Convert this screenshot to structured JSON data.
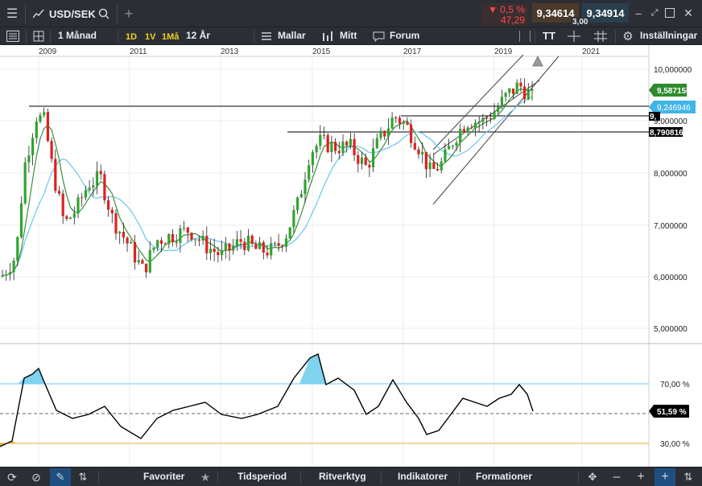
{
  "topbar": {
    "symbol": "USD/SEK",
    "change_pct": "▼ 0,5 %",
    "change_abs": "47,29",
    "bid": "9,34614",
    "ask": "9,34914",
    "spread": "3,00"
  },
  "toolbar": {
    "interval": "1 Månad",
    "range_1d": "1D",
    "range_1v": "1V",
    "range_1ma": "1Må",
    "range_12ar": "12 År",
    "mallar": "Mallar",
    "mitt": "Mitt",
    "forum": "Forum",
    "tt": "TT",
    "settings": "Inställningar"
  },
  "chart": {
    "x_labels": [
      "2009",
      "2011",
      "2013",
      "2015",
      "2017",
      "2019",
      "2021"
    ],
    "y_labels": [
      "10,000000",
      "9,000000",
      "8,000000",
      "7,000000",
      "6,000000",
      "5,000000"
    ],
    "price_tag_green": "9,587155",
    "price_tag_blue": "9,246946",
    "price_tag_black_1": "9,",
    "price_tag_black_2": "8,790816",
    "rsi_labels": [
      "70,00 %",
      "30,00 %"
    ],
    "rsi_tag": "51,59 %",
    "colors": {
      "up": "#2fa52f",
      "down": "#e02020",
      "ma_short": "#3a8f3a",
      "ma_long": "#6cc6ec",
      "rsi_band_top": "#6cc6ec",
      "rsi_band_bottom": "#e0b030",
      "fill_overbought": "#7fd3ee"
    }
  },
  "bottombar": {
    "favoriter": "Favoriter",
    "tidsperiod": "Tidsperiod",
    "ritverktyg": "Ritverktyg",
    "indikatorer": "Indikatorer",
    "formationer": "Formationer"
  }
}
